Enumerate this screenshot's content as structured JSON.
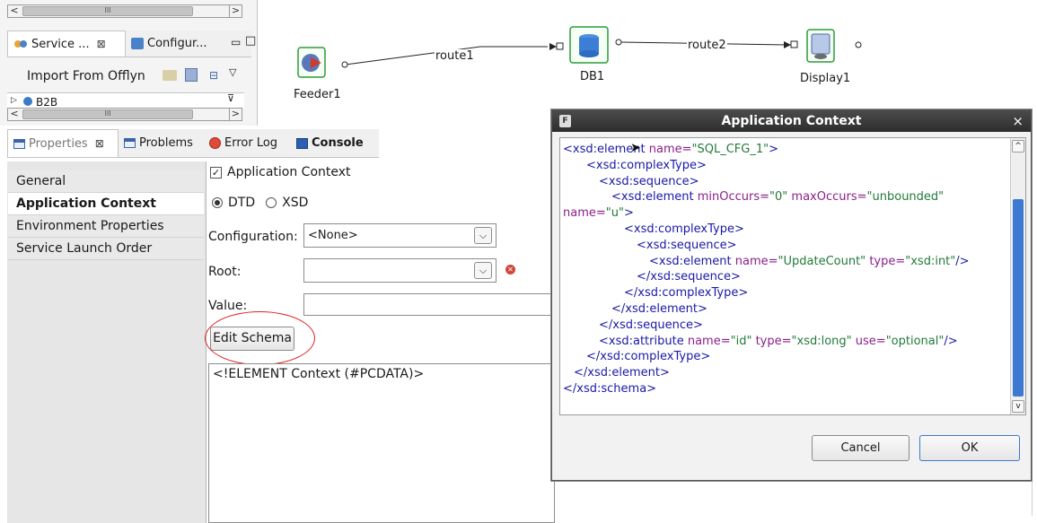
{
  "explorer": {
    "tabs": [
      "Service ...",
      "Configur..."
    ],
    "import_label": "Import From Offlyn",
    "tree_item": "B2B"
  },
  "diagram": {
    "nodes": [
      "Feeder1",
      "DB1",
      "Display1"
    ],
    "routes": [
      "route1",
      "route2"
    ]
  },
  "bottom_tabs": [
    "Properties",
    "Problems",
    "Error Log",
    "Console"
  ],
  "sidebar": {
    "items": [
      "General",
      "Application Context",
      "Environment Properties",
      "Service Launch Order"
    ],
    "selected": "Application Context"
  },
  "form": {
    "app_context_checkbox": "Application Context",
    "radio_dtd": "DTD",
    "radio_xsd": "XSD",
    "configuration_label": "Configuration:",
    "configuration_value": "<None>",
    "root_label": "Root:",
    "root_value": "",
    "value_label": "Value:",
    "value_text": "",
    "edit_schema_button": "Edit Schema",
    "schema_text": "<!ELEMENT Context (#PCDATA)>"
  },
  "dialog": {
    "title": "Application Context",
    "cancel_label": "Cancel",
    "ok_label": "OK",
    "code": {
      "l1_tag": "<xsd:element",
      "l1_attr": "name=",
      "l1_val": "\"SQL_CFG_1\"",
      "l1_end": ">",
      "l2": "<xsd:complexType>",
      "l3": "<xsd:sequence>",
      "l4_tag": "<xsd:element",
      "l4_attr1": "minOccurs=",
      "l4_val1": "\"0\"",
      "l4_attr2": "maxOccurs=",
      "l4_val2": "\"unbounded\"",
      "l4_attr3": "name=",
      "l4_val3": "\"u\"",
      "l4_end": ">",
      "l5": "<xsd:complexType>",
      "l6": "<xsd:sequence>",
      "l7_tag": "<xsd:element",
      "l7_attr1": "name=",
      "l7_val1": "\"UpdateCount\"",
      "l7_attr2": "type=",
      "l7_val2": "\"xsd:int\"",
      "l7_end": "/>",
      "l8": "</xsd:sequence>",
      "l9": "</xsd:complexType>",
      "l10": "</xsd:element>",
      "l11": "</xsd:sequence>",
      "l12_tag": "<xsd:attribute",
      "l12_attr1": "name=",
      "l12_val1": "\"id\"",
      "l12_attr2": "type=",
      "l12_val2": "\"xsd:long\"",
      "l12_attr3": "use=",
      "l12_val3": "\"optional\"",
      "l12_end": "/>",
      "l13": "</xsd:complexType>",
      "l14": "</xsd:element>",
      "l15": "</xsd:schema>"
    }
  }
}
